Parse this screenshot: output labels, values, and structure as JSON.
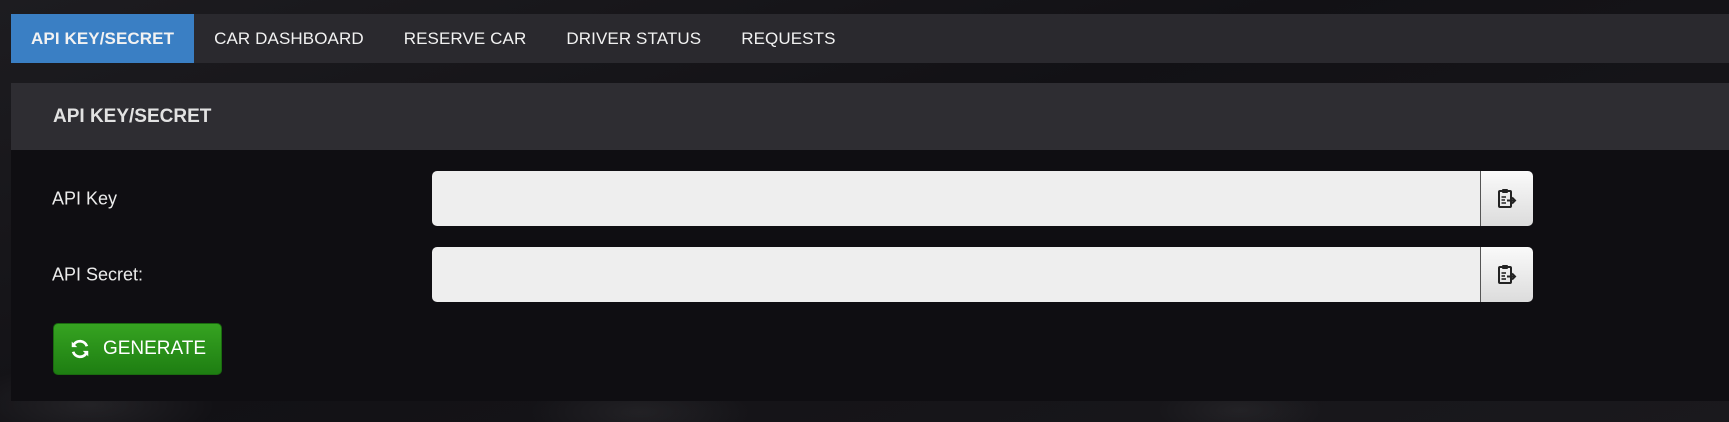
{
  "nav": {
    "items": [
      {
        "label": "API KEY/SECRET",
        "active": true
      },
      {
        "label": "CAR DASHBOARD",
        "active": false
      },
      {
        "label": "RESERVE CAR",
        "active": false
      },
      {
        "label": "DRIVER STATUS",
        "active": false
      },
      {
        "label": "REQUESTS",
        "active": false
      }
    ]
  },
  "panel": {
    "title": "API KEY/SECRET",
    "api_key": {
      "label": "API Key",
      "value": "",
      "copy_icon": "clipboard-copy-icon"
    },
    "api_secret": {
      "label": "API Secret:",
      "value": "",
      "copy_icon": "clipboard-copy-icon"
    },
    "generate_button": {
      "label": "GENERATE",
      "icon": "refresh-icon"
    }
  },
  "colors": {
    "nav_background": "#2a292e",
    "nav_active": "#3a7fc4",
    "panel_heading": "#2e2d32",
    "panel_body": "#0f0e12",
    "input_background": "#eeeeee",
    "generate_green": "#2a9119"
  }
}
